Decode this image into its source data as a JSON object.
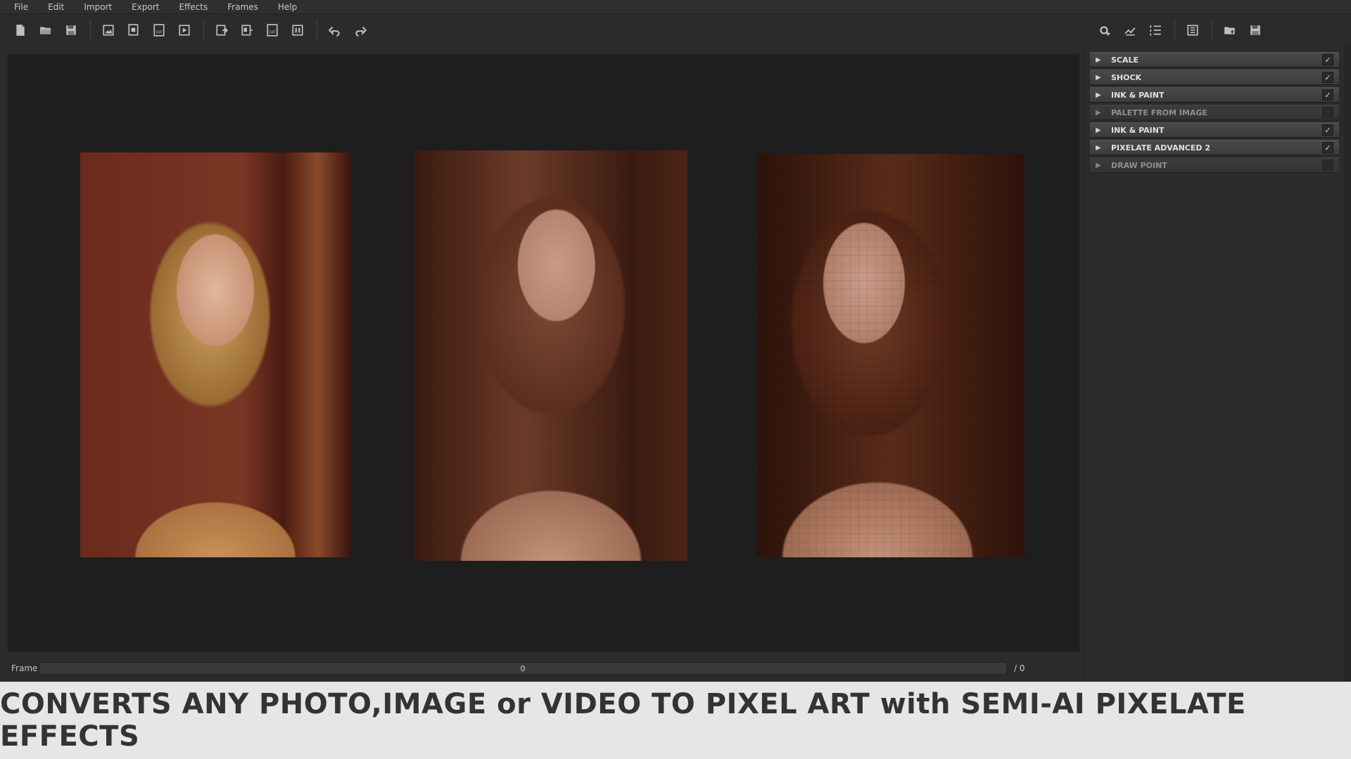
{
  "menu": [
    "File",
    "Edit",
    "Import",
    "Export",
    "Effects",
    "Frames",
    "Help"
  ],
  "toolbar": {
    "left_icons": [
      "new-file-icon",
      "open-folder-icon",
      "save-icon",
      "import-image-icon",
      "import-sequence-icon",
      "import-gif-icon",
      "import-video-icon",
      "export-image-icon",
      "export-sequence-icon",
      "export-gif-icon",
      "export-video-icon",
      "undo-icon",
      "redo-icon"
    ],
    "right_icons": [
      "add-effect-icon",
      "sort-effects-icon",
      "list-effects-icon",
      "effect-settings-icon",
      "load-preset-icon",
      "save-preset-icon"
    ]
  },
  "frame": {
    "label": "Frame",
    "value": "0",
    "total": "/ 0"
  },
  "effects": [
    {
      "label": "SCALE",
      "enabled": true
    },
    {
      "label": "SHOCK",
      "enabled": true
    },
    {
      "label": "INK & PAINT",
      "enabled": true
    },
    {
      "label": "PALETTE FROM IMAGE",
      "enabled": false
    },
    {
      "label": "INK & PAINT",
      "enabled": true
    },
    {
      "label": "PIXELATE ADVANCED 2",
      "enabled": true
    },
    {
      "label": "DRAW POINT",
      "enabled": false
    }
  ],
  "caption": "CONVERTS ANY PHOTO,IMAGE or VIDEO TO PIXEL ART with SEMI-AI PIXELATE EFFECTS",
  "colors": {
    "background": "#2b2b2b",
    "canvas": "#1e1e1e",
    "caption_bg": "#e6e6e6",
    "caption_text": "#333333"
  }
}
